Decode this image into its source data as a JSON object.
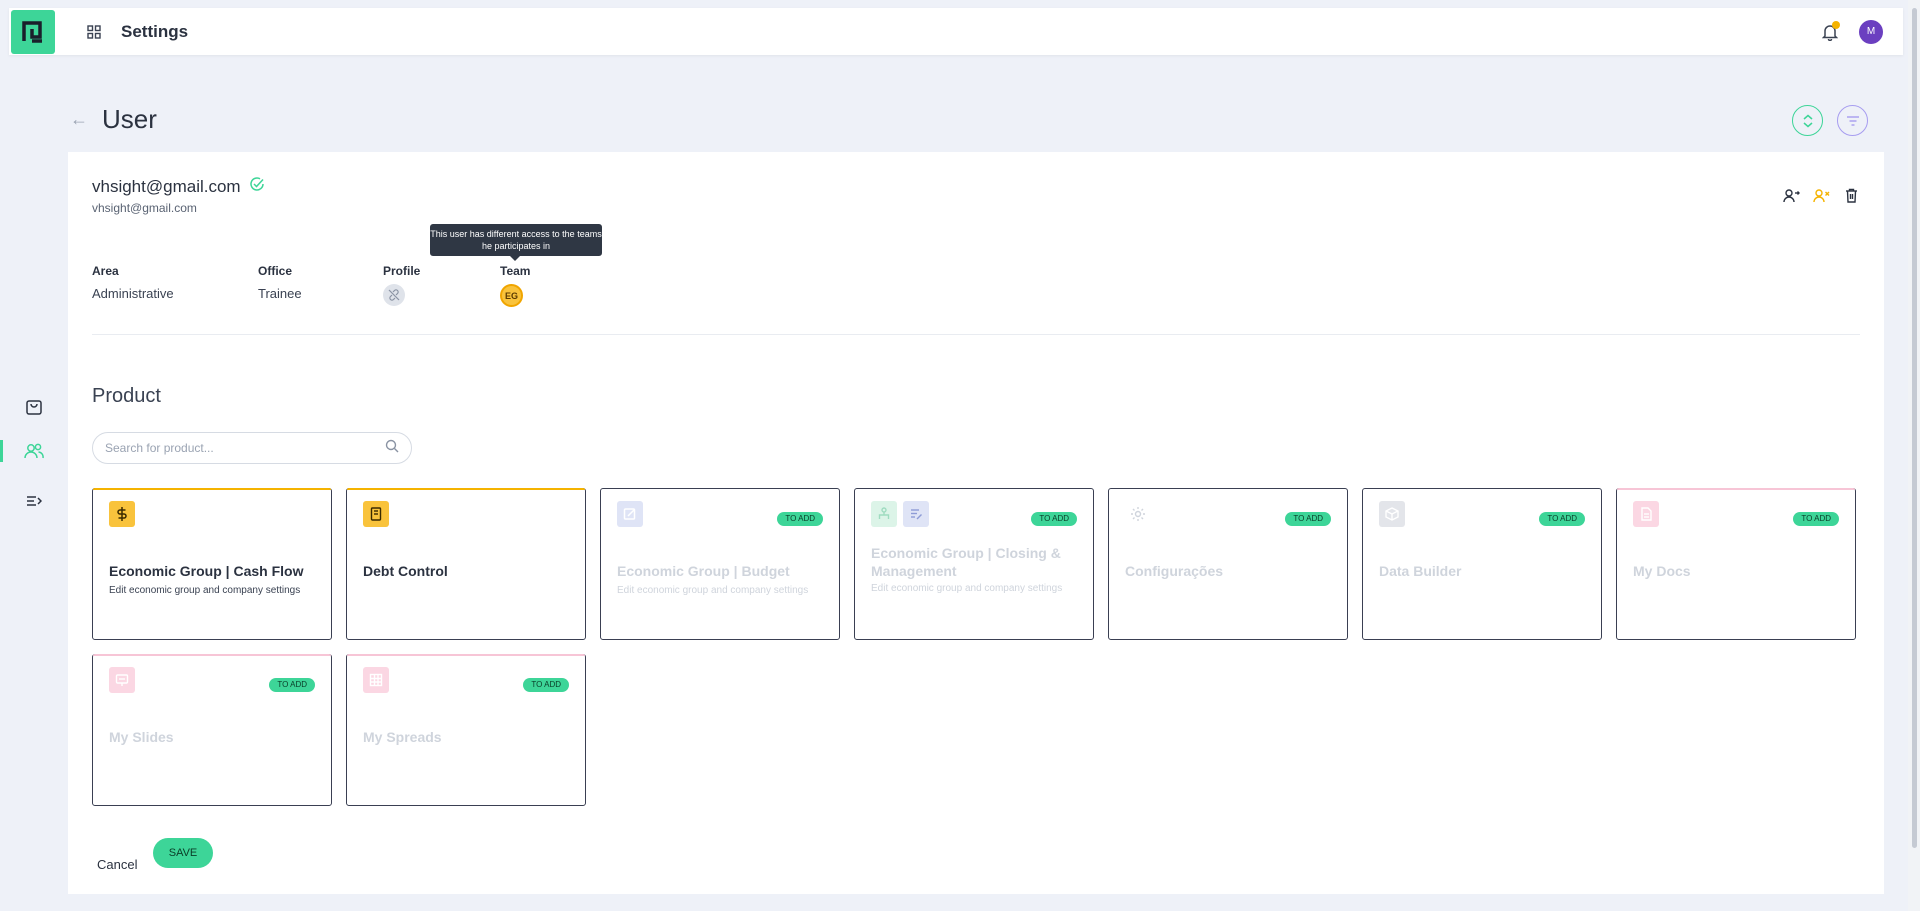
{
  "topbar": {
    "title": "Settings",
    "avatar_initial": "M"
  },
  "page": {
    "title": "User"
  },
  "user": {
    "email": "vhsight@gmail.com",
    "email_sub": "vhsight@gmail.com",
    "tooltip": "This user has different access to the teams he participates in",
    "fields": {
      "area_label": "Area",
      "area_value": "Administrative",
      "office_label": "Office",
      "office_value": "Trainee",
      "profile_label": "Profile",
      "team_label": "Team",
      "team_value": "EG"
    }
  },
  "product": {
    "title": "Product",
    "search_placeholder": "Search for product...",
    "badge_label": "TO ADD",
    "tiles": [
      {
        "name": "Economic Group | Cash Flow",
        "desc": "Edit economic group and company settings",
        "icon": "dollar-icon"
      },
      {
        "name": "Debt Control",
        "desc": "",
        "icon": "book-icon"
      },
      {
        "name": "Economic Group | Budget",
        "desc": "Edit economic group and company settings",
        "icon": "edit-doc-icon"
      },
      {
        "name": "Economic Group | Closing & Management",
        "desc": "Edit economic group and company settings",
        "icon": "org-chart-icon"
      },
      {
        "name": "Configurações",
        "desc": "",
        "icon": "gear-icon"
      },
      {
        "name": "Data Builder",
        "desc": "",
        "icon": "cube-icon"
      },
      {
        "name": "My Docs",
        "desc": "",
        "icon": "doc-icon"
      },
      {
        "name": "My Slides",
        "desc": "",
        "icon": "slides-icon"
      },
      {
        "name": "My Spreads",
        "desc": "",
        "icon": "grid-icon"
      }
    ]
  },
  "actions": {
    "cancel": "Cancel",
    "save": "SAVE"
  },
  "colors": {
    "accent": "#3dd598",
    "yellow": "#f9c33c",
    "pink": "#f7c5d6",
    "navy": "#3a3f52"
  }
}
